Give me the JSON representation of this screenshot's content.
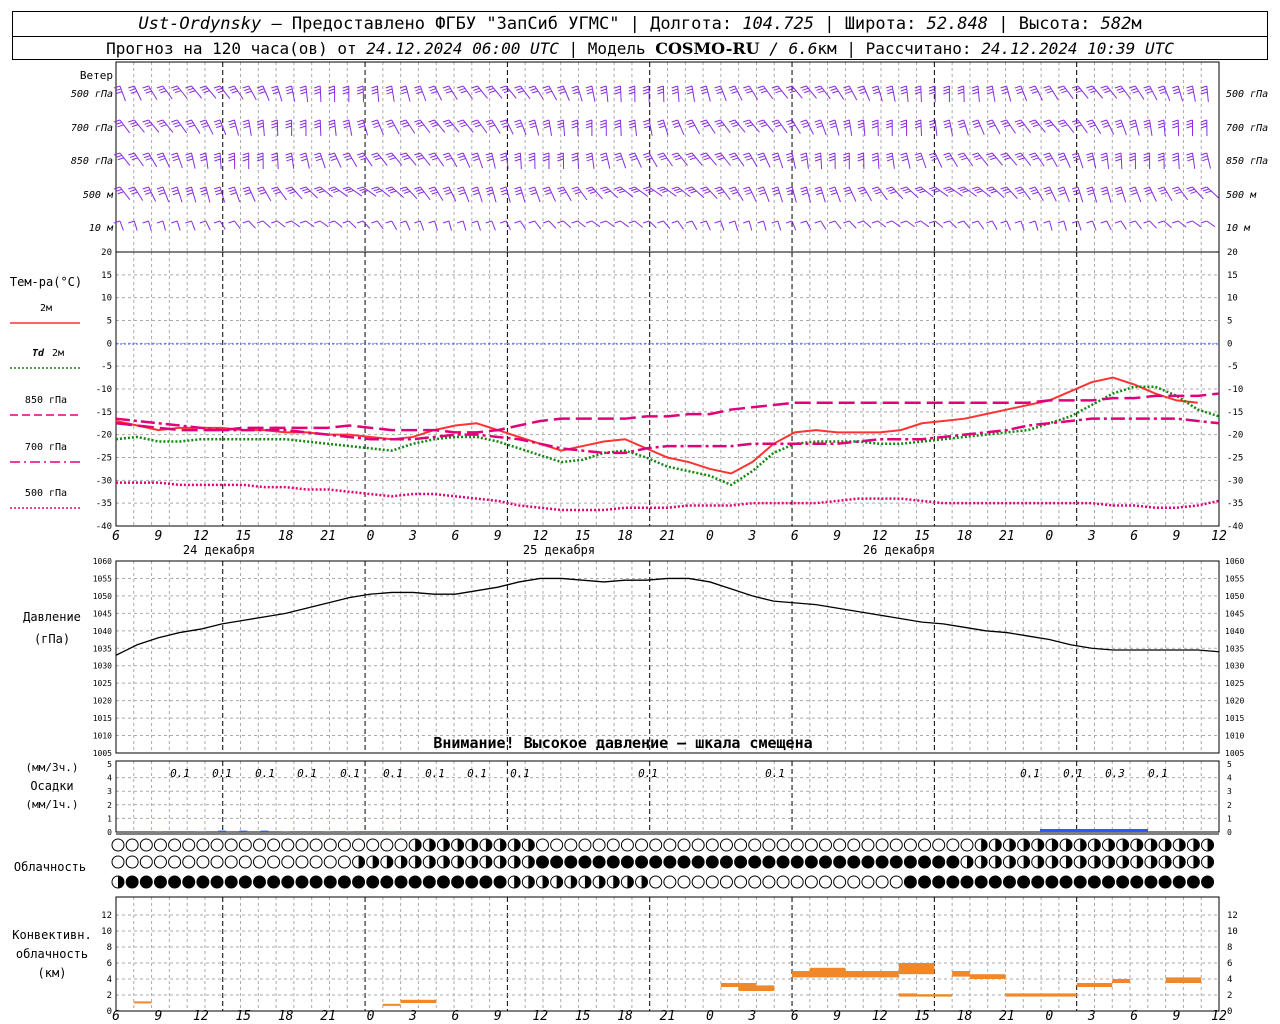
{
  "header": {
    "station": "Ust-Ordynsky",
    "provider": "— Предоставлено ФГБУ \"ЗапСиб УГМС\" |",
    "lon_label": "Долгота:",
    "lon_value": "104.725",
    "lat_label": "| Широта:",
    "lat_value": "52.848",
    "alt_label": "| Высота:",
    "alt_value": "582",
    "alt_unit": "м",
    "forecast_label": "Прогноз на 120 часа(ов) от",
    "forecast_time": "24.12.2024 06:00 UTC",
    "model_label": "| Модель",
    "model_name": "COSMO-RU",
    "model_res": "/ 6.6",
    "model_res_unit": "км",
    "calc_label": "| Рассчитано:",
    "calc_time": "24.12.2024 10:39 UTC"
  },
  "time_axis": {
    "hour_labels": [
      "6",
      "9",
      "12",
      "15",
      "18",
      "21",
      "0",
      "3",
      "6",
      "9",
      "12",
      "15",
      "18",
      "21",
      "0",
      "3",
      "6",
      "9",
      "12",
      "15",
      "18",
      "21",
      "0",
      "3",
      "6",
      "9",
      "12"
    ],
    "day_labels": [
      "24 декабря",
      "25 декабря",
      "26 декабря"
    ]
  },
  "wind_panel": {
    "title": "Ветер",
    "levels": [
      "500 гПа",
      "700 гПа",
      "850 гПа",
      "500 м",
      "10  м"
    ]
  },
  "temperature_panel": {
    "title": "Тем-ра(°С)",
    "legend": [
      {
        "label": "2м",
        "color": "#ff3333",
        "style": "solid"
      },
      {
        "label_italic": "Td",
        "label": "2м",
        "color": "#118811",
        "style": "dotted"
      },
      {
        "label": "850 гПа",
        "color": "#e0007a",
        "style": "dashed"
      },
      {
        "label": "700 гПа",
        "color": "#e0007a",
        "style": "dashdot"
      },
      {
        "label": "500 гПа",
        "color": "#e0007a",
        "style": "dotted"
      }
    ]
  },
  "pressure_panel": {
    "title_line1": "Давление",
    "title_line2": "(гПа)",
    "warning": "Внимание! Высокое давление — шкала смещена"
  },
  "precip_panel": {
    "label_top": "(мм/3ч.)",
    "label_mid": "Осадки",
    "label_bottom": "(мм/1ч.)",
    "amounts": [
      "0.1",
      "0.1",
      "0.1",
      "0.1",
      "0.1",
      "0.1",
      "0.1",
      "0.1",
      "0.1",
      "0.1",
      "0.1",
      "0.1",
      "0.1",
      "0.3",
      "0.1"
    ]
  },
  "cloud_panel": {
    "title": "Облачность"
  },
  "convective_panel": {
    "title_line1": "Конвективн.",
    "title_line2": "облачность",
    "title_line3": "(км)"
  },
  "chart_data": [
    {
      "type": "line",
      "title": "Тем-ра(°С)",
      "x": [
        0,
        3,
        6,
        9,
        12,
        15,
        18,
        21,
        24,
        27,
        30,
        33,
        36,
        39,
        42,
        45,
        48,
        51,
        54,
        57,
        60,
        63,
        66,
        69,
        72,
        75,
        78,
        81,
        84,
        87,
        90,
        93,
        96,
        99,
        102,
        105,
        108,
        111,
        114,
        117,
        120,
        123,
        126,
        129,
        132,
        135,
        138,
        141,
        144,
        147,
        150,
        153,
        156
      ],
      "ylim": [
        -40,
        20
      ],
      "series": [
        {
          "name": "2м",
          "values": [
            -17,
            -18,
            -19,
            -18.5,
            -18.5,
            -18.5,
            -19,
            -19,
            -19.5,
            -19.5,
            -20,
            -20,
            -20.5,
            -21,
            -20.5,
            -19,
            -18,
            -17.5,
            -19,
            -20.5,
            -22,
            -23.5,
            -22.5,
            -21.5,
            -21,
            -23,
            -25,
            -26,
            -27.5,
            -28.5,
            -26,
            -22,
            -19.5,
            -19,
            -19.5,
            -19.5,
            -19.5,
            -19,
            -17.5,
            -17,
            -16.5,
            -15.5,
            -14.5,
            -13.5,
            -12.5,
            -10.5,
            -8.5,
            -7.5,
            -9,
            -11,
            -12.5,
            -13
          ]
        },
        {
          "name": "Td 2м",
          "values": [
            -21,
            -20.5,
            -21.5,
            -21.5,
            -21,
            -21,
            -21,
            -21,
            -21,
            -21.5,
            -22,
            -22.5,
            -23,
            -23.5,
            -22,
            -21,
            -20.5,
            -20.5,
            -21.5,
            -23,
            -24.5,
            -26,
            -25.5,
            -24,
            -23.5,
            -25,
            -27,
            -28,
            -29,
            -31,
            -28,
            -24,
            -22,
            -21.5,
            -21.5,
            -21.5,
            -22,
            -22,
            -21.5,
            -21,
            -20.5,
            -20,
            -19.5,
            -19,
            -17.5,
            -16,
            -13.5,
            -11,
            -9.5,
            -9.5,
            -11.5,
            -14.5,
            -16
          ]
        },
        {
          "name": "850 гПа",
          "values": [
            -17.5,
            -18,
            -18.5,
            -19,
            -19,
            -19,
            -18.5,
            -18.5,
            -18.5,
            -18.5,
            -18.5,
            -18,
            -18.5,
            -19,
            -19,
            -19,
            -19.5,
            -19.5,
            -19,
            -18,
            -17,
            -16.5,
            -16.5,
            -16.5,
            -16.5,
            -16,
            -16,
            -15.5,
            -15.5,
            -14.5,
            -14,
            -13.5,
            -13,
            -13,
            -13,
            -13,
            -13,
            -13,
            -13,
            -13,
            -13,
            -13,
            -13,
            -13,
            -12.5,
            -12.5,
            -12.5,
            -12,
            -12,
            -11.5,
            -11.5,
            -11.5,
            -11
          ]
        },
        {
          "name": "700 гПа",
          "values": [
            -16.5,
            -17,
            -17.5,
            -18,
            -18.5,
            -19,
            -19,
            -19,
            -19,
            -19.5,
            -20,
            -20.5,
            -21,
            -21,
            -21,
            -20.5,
            -20,
            -20,
            -20.5,
            -21,
            -22,
            -23,
            -23.5,
            -24,
            -24,
            -23,
            -22.5,
            -22.5,
            -22.5,
            -22.5,
            -22,
            -22,
            -22,
            -22,
            -22,
            -21.5,
            -21,
            -21,
            -21,
            -20.5,
            -20,
            -19.5,
            -19,
            -18,
            -17.5,
            -17,
            -16.5,
            -16.5,
            -16.5,
            -16.5,
            -16.5,
            -17,
            -17.5
          ]
        },
        {
          "name": "500 гПа",
          "values": [
            -30.5,
            -30.5,
            -30.5,
            -31,
            -31,
            -31,
            -31,
            -31.5,
            -31.5,
            -32,
            -32,
            -32.5,
            -33,
            -33.5,
            -33,
            -33,
            -33.5,
            -34,
            -34.5,
            -35.5,
            -36,
            -36.5,
            -36.5,
            -36.5,
            -36,
            -36,
            -36,
            -35.5,
            -35.5,
            -35.5,
            -35,
            -35,
            -35,
            -35,
            -34.5,
            -34,
            -34,
            -34,
            -34.5,
            -35,
            -35,
            -35,
            -35,
            -35,
            -35,
            -35,
            -35,
            -35.5,
            -35.5,
            -36,
            -36,
            -35.5,
            -34.5
          ]
        }
      ]
    },
    {
      "type": "line",
      "title": "Давление",
      "ylabel": "(гПа)",
      "x": [
        0,
        3,
        6,
        9,
        12,
        15,
        18,
        21,
        24,
        27,
        30,
        33,
        36,
        39,
        42,
        45,
        48,
        51,
        54,
        57,
        60,
        63,
        66,
        69,
        72,
        75,
        78,
        81,
        84,
        87,
        90,
        93,
        96,
        99,
        102,
        105,
        108,
        111,
        114,
        117,
        120,
        123,
        126,
        129,
        132,
        135,
        138,
        141,
        144,
        147,
        150,
        153,
        156
      ],
      "ylim": [
        1005,
        1060
      ],
      "series": [
        {
          "name": "Давление",
          "values": [
            1033,
            1036,
            1038,
            1039.5,
            1040.5,
            1042,
            1043,
            1044,
            1045,
            1046.5,
            1048,
            1049.5,
            1050.5,
            1051,
            1051,
            1050.5,
            1050.5,
            1051.5,
            1052.5,
            1054,
            1055,
            1055,
            1054.5,
            1054,
            1054.5,
            1054.5,
            1055,
            1055,
            1054,
            1052,
            1050,
            1048.5,
            1048,
            1047.5,
            1046.5,
            1045.5,
            1044.5,
            1043.5,
            1042.5,
            1042,
            1041,
            1040,
            1039.5,
            1038.5,
            1037.5,
            1036,
            1035,
            1034.5,
            1034.5,
            1034.5,
            1034.5,
            1034.5,
            1034
          ]
        }
      ]
    },
    {
      "type": "bar",
      "title": "Осадки",
      "ylabel": "(мм/3ч.)",
      "ylim": [
        0,
        5
      ],
      "x": [
        6,
        9,
        12,
        15,
        18,
        21,
        24,
        27,
        30,
        33,
        36,
        39,
        42,
        45,
        48,
        51,
        54,
        57,
        60,
        63,
        66,
        69,
        72,
        75,
        78,
        81,
        84,
        87,
        90,
        93,
        96,
        99,
        102,
        105,
        108,
        111,
        114,
        117,
        120,
        123,
        126,
        129,
        132,
        135,
        138,
        141,
        144,
        147,
        150,
        153,
        156
      ],
      "values": [
        0.05,
        0,
        0.05,
        0.1,
        0.1,
        0.1,
        0.05,
        0,
        0.05,
        0.05,
        0,
        0.05,
        0,
        0,
        0,
        0,
        0,
        0,
        0,
        0,
        0,
        0,
        0,
        0,
        0,
        0,
        0,
        0,
        0,
        0,
        0,
        0,
        0,
        0,
        0,
        0,
        0,
        0,
        0,
        0,
        0,
        0,
        0,
        0,
        0,
        0,
        0,
        0,
        0,
        0,
        0
      ]
    },
    {
      "type": "bar",
      "title": "Конвективн. облачность",
      "ylabel": "(км)",
      "ylim": [
        0,
        14
      ],
      "segments": [
        {
          "x0": 3,
          "x1": 6,
          "bottom": 1,
          "top": 1.2
        },
        {
          "x0": 45,
          "x1": 48,
          "bottom": 0.7,
          "top": 0.9
        },
        {
          "x0": 48,
          "x1": 54,
          "bottom": 1,
          "top": 1.4
        },
        {
          "x0": 102,
          "x1": 108,
          "bottom": 3,
          "top": 3.5
        },
        {
          "x0": 105,
          "x1": 111,
          "bottom": 2.5,
          "top": 3.2
        },
        {
          "x0": 114,
          "x1": 120,
          "bottom": 4.2,
          "top": 5
        },
        {
          "x0": 117,
          "x1": 123,
          "bottom": 4.6,
          "top": 5.4
        },
        {
          "x0": 120,
          "x1": 132,
          "bottom": 4.2,
          "top": 5
        },
        {
          "x0": 132,
          "x1": 138,
          "bottom": 4.6,
          "top": 6
        },
        {
          "x0": 132,
          "x1": 135,
          "bottom": 1.8,
          "top": 2.2
        },
        {
          "x0": 135,
          "x1": 141,
          "bottom": 1.8,
          "top": 2.1
        },
        {
          "x0": 141,
          "x1": 144,
          "bottom": 4.3,
          "top": 5
        },
        {
          "x0": 144,
          "x1": 150,
          "bottom": 4,
          "top": 4.6
        },
        {
          "x0": 150,
          "x1": 162,
          "bottom": 1.8,
          "top": 2.2
        },
        {
          "x0": 162,
          "x1": 168,
          "bottom": 3,
          "top": 3.5
        },
        {
          "x0": 168,
          "x1": 171,
          "bottom": 3.5,
          "top": 4
        },
        {
          "x0": 177,
          "x1": 183,
          "bottom": 3.5,
          "top": 4.2
        }
      ]
    }
  ]
}
